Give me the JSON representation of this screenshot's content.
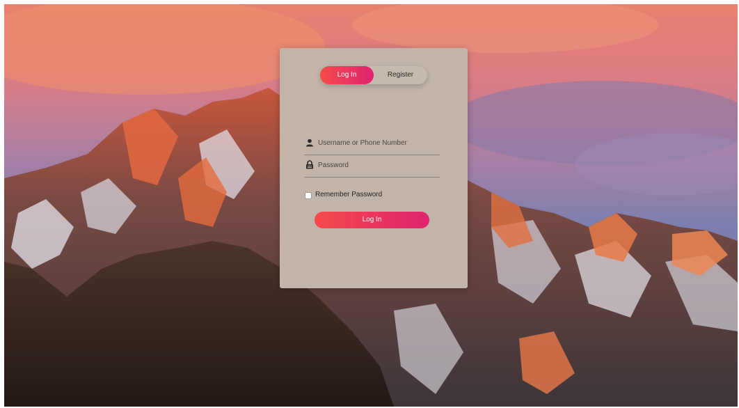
{
  "tabs": {
    "login_label": "Log In",
    "register_label": "Register"
  },
  "form": {
    "username_placeholder": "Username or Phone Number",
    "password_placeholder": "Password",
    "remember_label": "Remember Password",
    "submit_label": "Log In"
  },
  "icons": {
    "username": "user-icon",
    "password": "lock-icon"
  },
  "colors": {
    "accent_start": "#f64a4a",
    "accent_end": "#e0246f",
    "card": "#c2b4a9"
  }
}
